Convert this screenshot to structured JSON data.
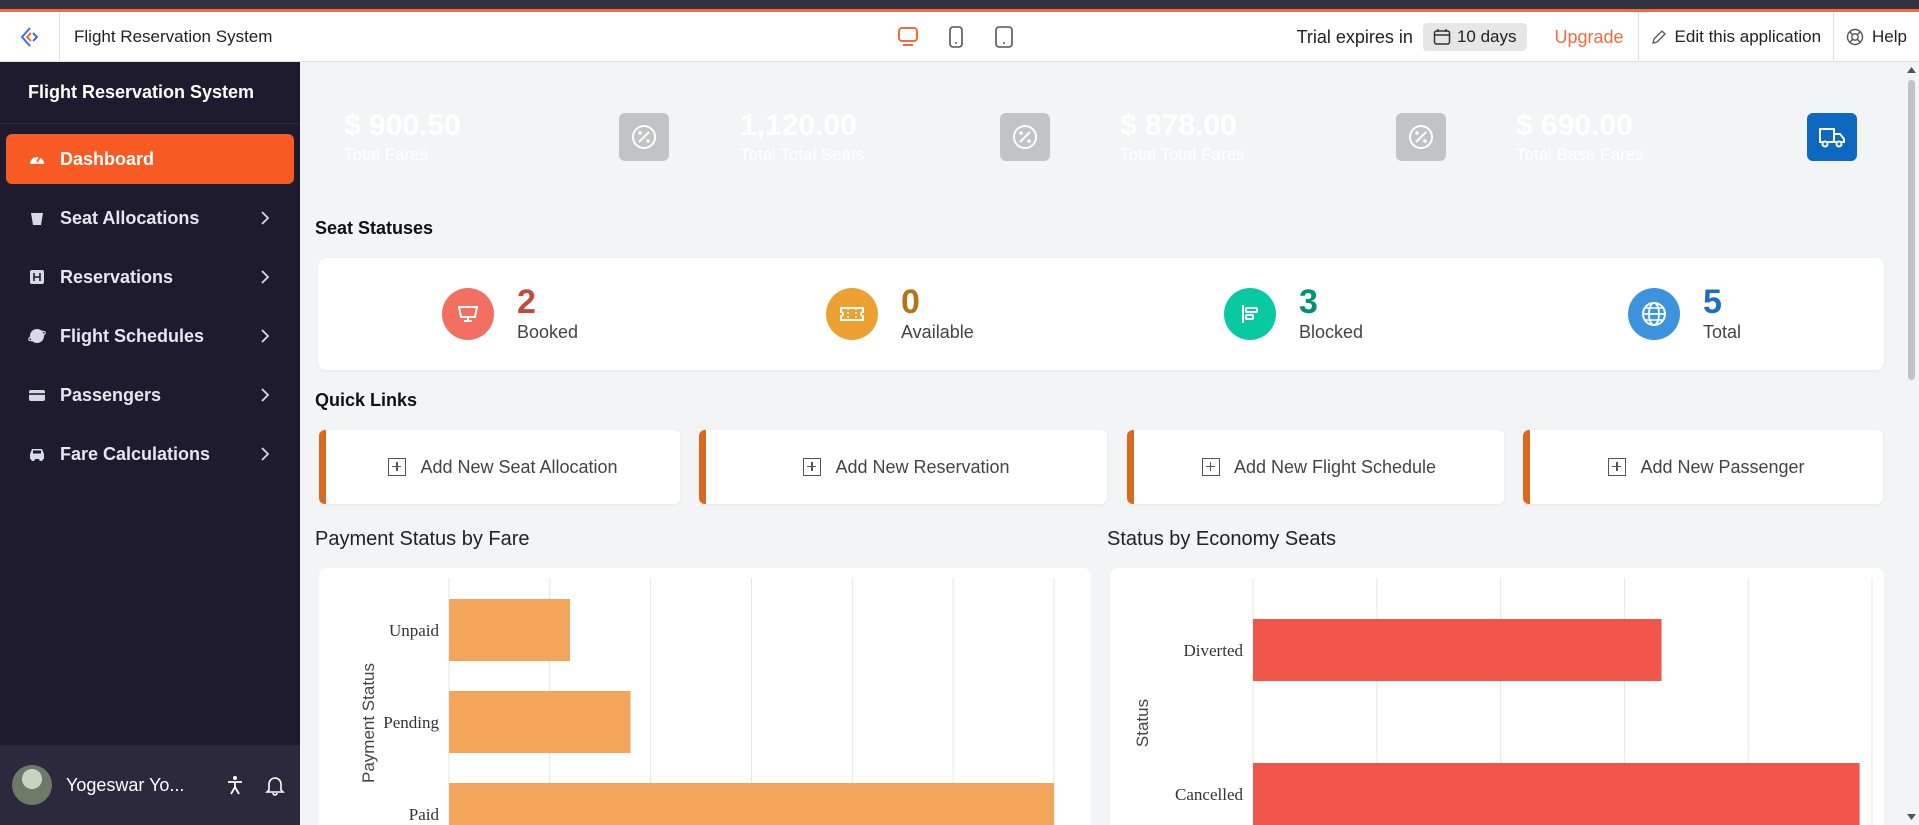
{
  "topbar": {
    "app_title": "Flight Reservation System",
    "trial_label": "Trial expires in",
    "trial_days": "10 days",
    "upgrade_label": "Upgrade",
    "edit_label": "Edit this application",
    "help_label": "Help"
  },
  "sidebar": {
    "title": "Flight Reservation System",
    "items": [
      {
        "label": "Dashboard",
        "icon": "dashboard-icon"
      },
      {
        "label": "Seat Allocations",
        "icon": "bucket-icon"
      },
      {
        "label": "Reservations",
        "icon": "h-icon"
      },
      {
        "label": "Flight Schedules",
        "icon": "globe-icon"
      },
      {
        "label": "Passengers",
        "icon": "card-icon"
      },
      {
        "label": "Fare Calculations",
        "icon": "car-icon"
      }
    ],
    "user_name": "Yogeswar Yo..."
  },
  "cards": [
    {
      "value": "$ 900.50",
      "label": "Total Fares",
      "color": "#f87262"
    },
    {
      "value": "1,120.00",
      "label": "Total Total Seats",
      "color": "#eea032"
    },
    {
      "value": "$ 878.00",
      "label": "Total Total Fares",
      "color": "#02cba3"
    },
    {
      "value": "$ 690.00",
      "label": "Total Base Fares",
      "color": "#3d93dd"
    }
  ],
  "seat_statuses": {
    "title": "Seat Statuses",
    "items": [
      {
        "value": "2",
        "label": "Booked",
        "color": "#f36f61",
        "num_color": "#c24a3c"
      },
      {
        "value": "0",
        "label": "Available",
        "color": "#eda132",
        "num_color": "#b57516"
      },
      {
        "value": "3",
        "label": "Blocked",
        "color": "#09c9a2",
        "num_color": "#059173"
      },
      {
        "value": "5",
        "label": "Total",
        "color": "#3d93dd",
        "num_color": "#1f6fbd"
      }
    ]
  },
  "quick_links": {
    "title": "Quick Links",
    "items": [
      "Add New Seat Allocation",
      "Add New Reservation",
      "Add New Flight Schedule",
      "Add New Passenger"
    ]
  },
  "chart_data": [
    {
      "type": "bar",
      "title": "Payment Status by Fare",
      "orientation": "horizontal",
      "categories": [
        "Unpaid",
        "Pending",
        "Paid"
      ],
      "values": [
        120,
        180,
        600
      ],
      "xlim": [
        0,
        600
      ],
      "ylabel": "Payment Status",
      "color": "#f4a55c",
      "grid": true
    },
    {
      "type": "bar",
      "title": "Status by Economy Seats",
      "orientation": "horizontal",
      "categories": [
        "Diverted",
        "Cancelled"
      ],
      "values": [
        330,
        490
      ],
      "xlim": [
        0,
        500
      ],
      "ylabel": "Status",
      "color": "#f0564a",
      "grid": true
    }
  ]
}
